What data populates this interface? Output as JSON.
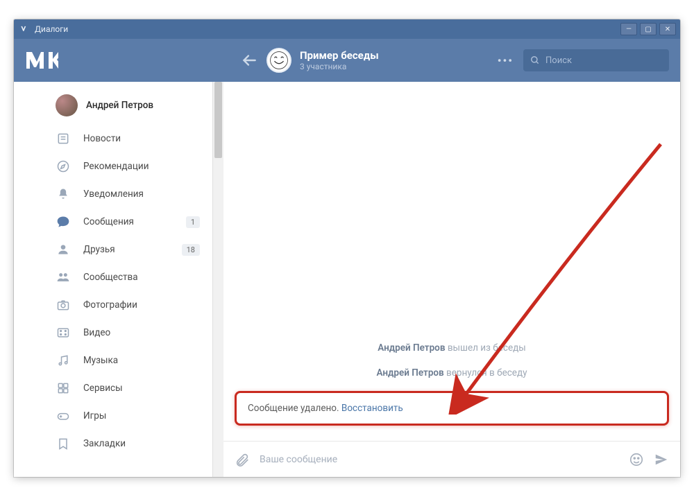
{
  "window": {
    "title": "Диалоги"
  },
  "header": {
    "chat_title": "Пример беседы",
    "chat_subtitle": "3 участника",
    "search_placeholder": "Поиск"
  },
  "sidebar": {
    "user_name": "Андрей Петров",
    "items": [
      {
        "icon": "news",
        "label": "Новости"
      },
      {
        "icon": "rec",
        "label": "Рекомендации"
      },
      {
        "icon": "bell",
        "label": "Уведомления"
      },
      {
        "icon": "msg",
        "label": "Сообщения",
        "badge": "1"
      },
      {
        "icon": "friends",
        "label": "Друзья",
        "badge": "18"
      },
      {
        "icon": "groups",
        "label": "Сообщества"
      },
      {
        "icon": "photos",
        "label": "Фотографии"
      },
      {
        "icon": "video",
        "label": "Видео"
      },
      {
        "icon": "music",
        "label": "Музыка"
      },
      {
        "icon": "svc",
        "label": "Сервисы"
      },
      {
        "icon": "games",
        "label": "Игры"
      },
      {
        "icon": "bookmarks",
        "label": "Закладки"
      }
    ]
  },
  "chat": {
    "sys1_name": "Андрей Петров",
    "sys1_action": " вышел из беседы",
    "sys2_name": "Андрей Петров",
    "sys2_action": " вернулся в беседу",
    "deleted_text": "Сообщение удалено. ",
    "restore_label": "Восстановить",
    "input_placeholder": "Ваше сообщение"
  }
}
